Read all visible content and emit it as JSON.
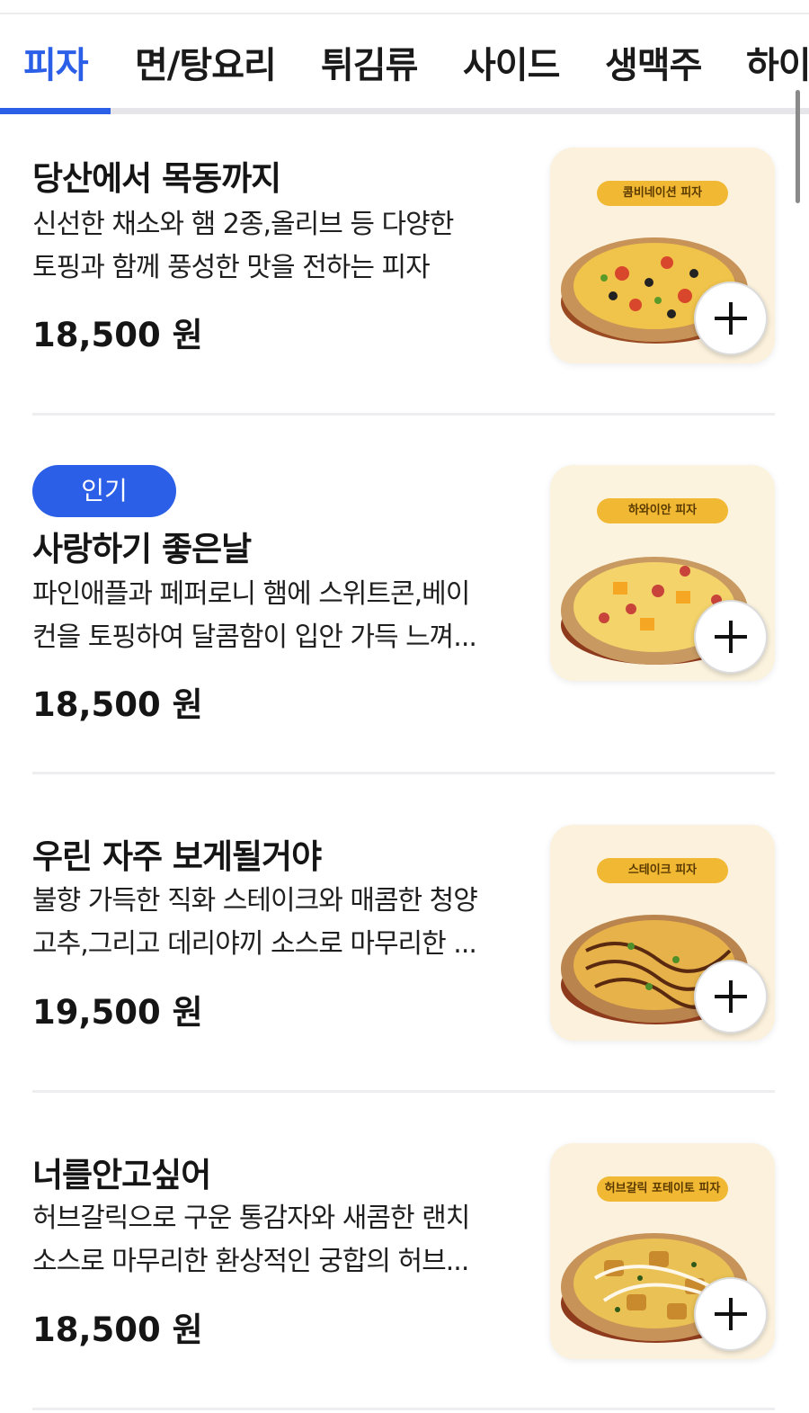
{
  "tabs": [
    {
      "label": "피자",
      "active": true
    },
    {
      "label": "면/탕요리",
      "active": false
    },
    {
      "label": "튀김류",
      "active": false
    },
    {
      "label": "사이드",
      "active": false
    },
    {
      "label": "생맥주",
      "active": false
    },
    {
      "label": "하이",
      "active": false
    }
  ],
  "colors": {
    "accent": "#2c5fe8",
    "thumb_bg": "#fbf1dc",
    "label_pill": "#f1b833"
  },
  "menu": [
    {
      "name": "당산에서 목동까지",
      "badge": "",
      "desc_line1": "신선한 채소와 햄 2종,올리브 등 다양한",
      "desc_line2": "토핑과 함께 풍성한 맛을 전하는 피자",
      "price": "18,500 원",
      "image_label": "콤비네이션 피자",
      "add_icon": "plus-icon"
    },
    {
      "name": "사랑하기 좋은날",
      "badge": "인기",
      "desc_line1": "파인애플과 페퍼로니 햄에 스위트콘,베이",
      "desc_line2": "컨을 토핑하여 달콤함이 입안 가득 느껴...",
      "price": "18,500 원",
      "image_label": "하와이안 피자",
      "add_icon": "plus-icon"
    },
    {
      "name": "우린 자주 보게될거야",
      "badge": "",
      "desc_line1": "불향 가득한 직화 스테이크와 매콤한 청양",
      "desc_line2": "고추,그리고 데리야끼 소스로 마무리한 ...",
      "price": "19,500 원",
      "image_label": "스테이크 피자",
      "add_icon": "plus-icon"
    },
    {
      "name": "너를안고싶어",
      "badge": "",
      "desc_line1": "허브갈릭으로 구운 통감자와 새콤한 랜치",
      "desc_line2": "소스로 마무리한 환상적인 궁합의 허브...",
      "price": "18,500 원",
      "image_label": "허브갈릭 포테이토 피자",
      "add_icon": "plus-icon"
    }
  ]
}
